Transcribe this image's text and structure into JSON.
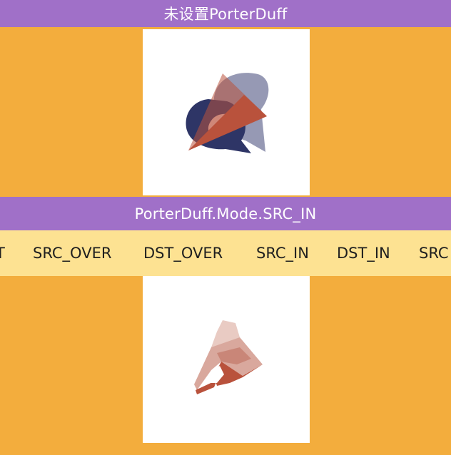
{
  "header": {
    "title": "未设置PorterDuff"
  },
  "mode_bar": {
    "label": "PorterDuff.Mode.SRC_IN"
  },
  "mode_tabs": [
    {
      "label": "T"
    },
    {
      "label": "SRC_OVER"
    },
    {
      "label": "DST_OVER"
    },
    {
      "label": "SRC_IN"
    },
    {
      "label": "DST_IN"
    },
    {
      "label": "SRC"
    }
  ],
  "colors": {
    "background": "#F3AD3D",
    "title_bar": "#A070C8",
    "tab_strip": "#FDE292",
    "canvas": "#FFFFFF",
    "navy_shape": "#2E3566",
    "lavender_shape": "#9699B4",
    "rust_triangle": "#B9523C",
    "mauve_overlap": "#967172"
  }
}
